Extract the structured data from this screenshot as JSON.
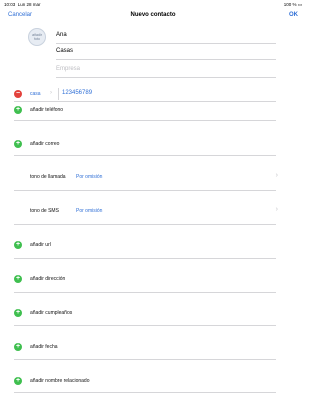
{
  "status_bar": {
    "time": "10:03",
    "date": "Lun 28 mar",
    "battery": "100 %"
  },
  "nav": {
    "cancel": "Cancelar",
    "title": "Nuevo contacto",
    "ok": "OK"
  },
  "avatar": {
    "line1": "añadir",
    "line2": "foto"
  },
  "name": {
    "first": "Ana",
    "last": "Casas",
    "company_placeholder": "Empresa"
  },
  "phone": {
    "type": "casa",
    "number": "123456789"
  },
  "actions": {
    "add_phone": "añadir teléfono",
    "add_email": "añadir correo",
    "add_url": "añadir url",
    "add_address": "añadir dirección",
    "add_birthday": "añadir cumpleaños",
    "add_date": "añadir fecha",
    "add_related": "añadir nombre relacionado"
  },
  "ringtone": {
    "label": "tono de llamada",
    "value": "Por omisión"
  },
  "texttone": {
    "label": "tono de SMS",
    "value": "Por omisión"
  },
  "colors": {
    "accent": "#2f6fd6",
    "add": "#3fbf4f",
    "remove": "#e3423c"
  }
}
